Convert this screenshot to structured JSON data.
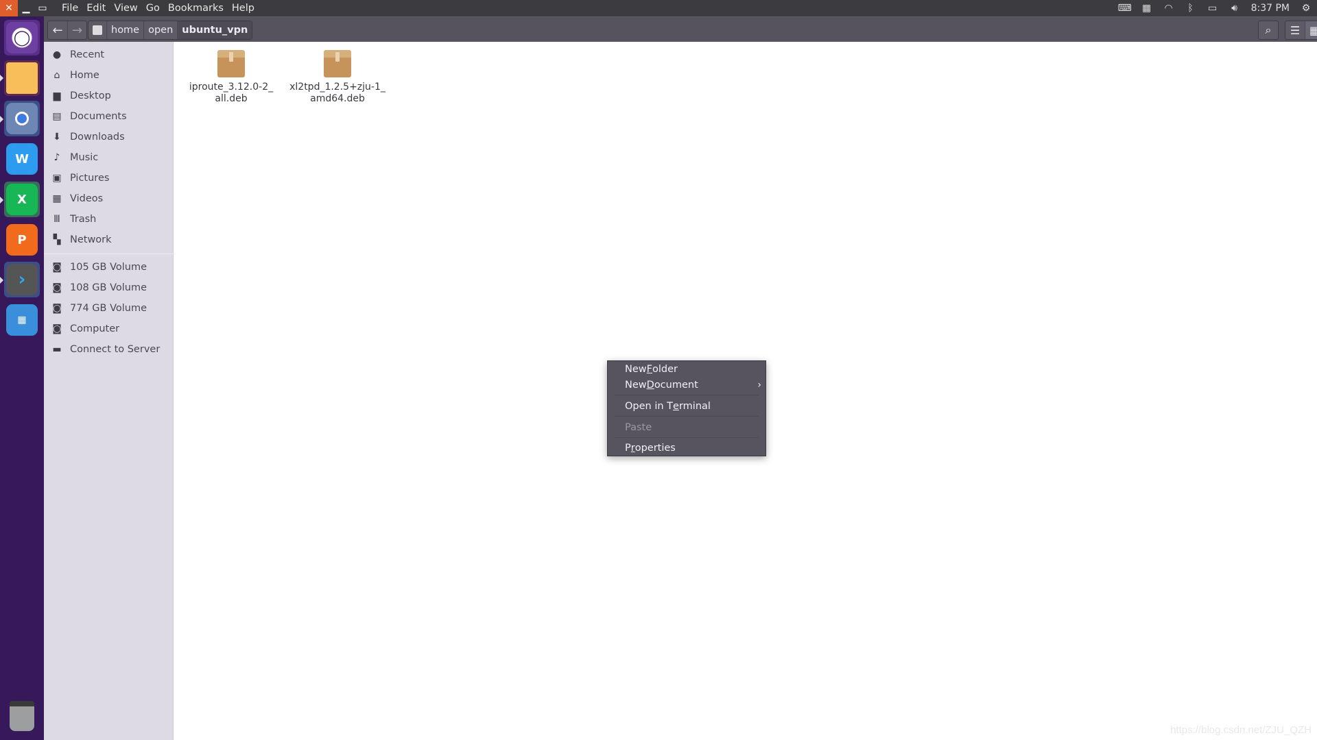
{
  "window": {
    "menus": [
      "File",
      "Edit",
      "View",
      "Go",
      "Bookmarks",
      "Help"
    ]
  },
  "tray": {
    "time": "8:37 PM"
  },
  "launcher": {
    "items": [
      "Ubuntu Dash",
      "Files",
      "Chromium",
      "WPS Writer",
      "WPS Spreadsheets",
      "WPS Presentation",
      "Remmina",
      "Workspace Switcher",
      "Trash"
    ]
  },
  "breadcrumb": {
    "items": [
      "home",
      "open",
      "ubuntu_vpn"
    ]
  },
  "sidebar": {
    "places": [
      "Recent",
      "Home",
      "Desktop",
      "Documents",
      "Downloads",
      "Music",
      "Pictures",
      "Videos",
      "Trash",
      "Network"
    ],
    "devices": [
      "105 GB Volume",
      "108 GB Volume",
      "774 GB Volume",
      "Computer",
      "Connect to Server"
    ]
  },
  "files": [
    {
      "line1": "iproute_3.12.0-2_",
      "line2": "all.deb"
    },
    {
      "line1": "xl2tpd_1.2.5+zju-1_",
      "line2": "amd64.deb"
    }
  ],
  "context_menu": {
    "new_folder": {
      "pre": "New ",
      "u": "F",
      "post": "older"
    },
    "new_document": {
      "pre": "New ",
      "u": "D",
      "post": "ocument"
    },
    "open_terminal": {
      "pre": "Open in T",
      "u": "e",
      "post": "rminal"
    },
    "paste": "Paste",
    "properties": {
      "pre": "P",
      "u": "r",
      "post": "operties"
    }
  },
  "watermark": "https://blog.csdn.net/ZJU_QZH"
}
